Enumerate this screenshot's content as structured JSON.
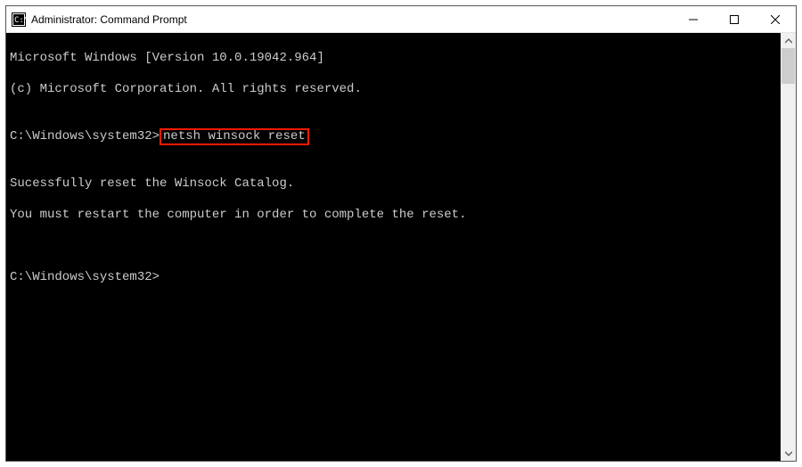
{
  "titlebar": {
    "title": "Administrator: Command Prompt"
  },
  "terminal": {
    "line1": "Microsoft Windows [Version 10.0.19042.964]",
    "line2": "(c) Microsoft Corporation. All rights reserved.",
    "blank1": "",
    "prompt1_prefix": "C:\\Windows\\system32>",
    "command1": "netsh winsock reset",
    "blank2": "",
    "result1": "Sucessfully reset the Winsock Catalog.",
    "result2": "You must restart the computer in order to complete the reset.",
    "blank3": "",
    "blank4": "",
    "prompt2": "C:\\Windows\\system32>"
  }
}
